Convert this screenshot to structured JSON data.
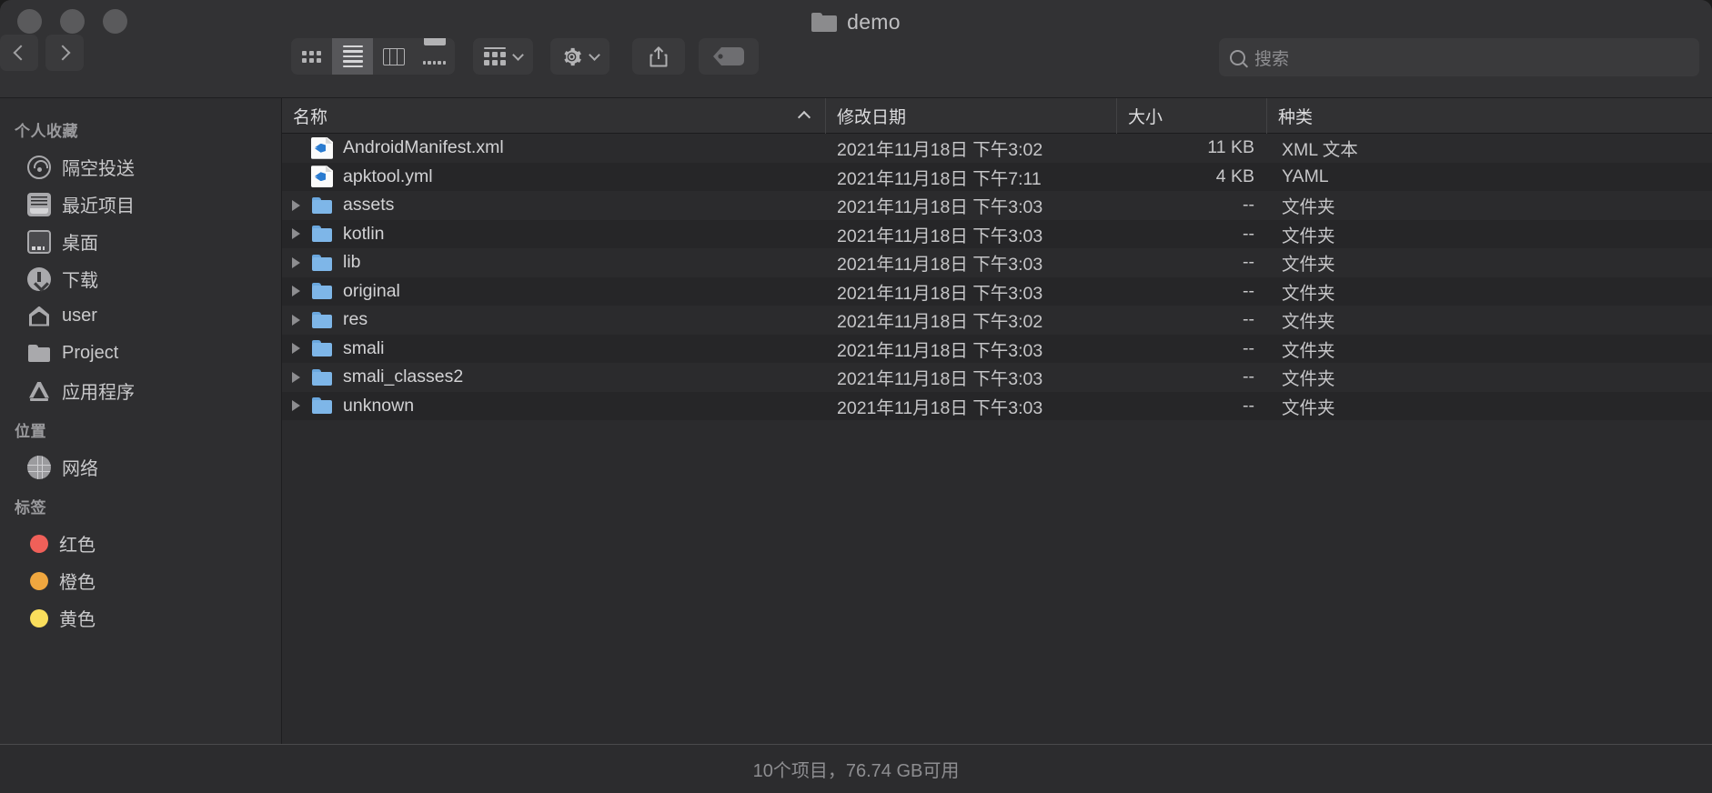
{
  "window": {
    "title": "demo",
    "traffic_lights": [
      "close",
      "minimize",
      "zoom"
    ]
  },
  "toolbar": {
    "back_label": "‹",
    "forward_label": "›",
    "view_modes": [
      {
        "name": "icon-view",
        "selected": false
      },
      {
        "name": "list-view",
        "selected": true
      },
      {
        "name": "column-view",
        "selected": false
      },
      {
        "name": "gallery-view",
        "selected": false
      }
    ],
    "group_by": "group-by",
    "actions": "actions",
    "share": "share",
    "tags": "tags"
  },
  "search": {
    "placeholder": "搜索",
    "value": ""
  },
  "sidebar": {
    "sections": [
      {
        "title": "个人收藏",
        "items": [
          {
            "label": "隔空投送",
            "icon": "airdrop-icon"
          },
          {
            "label": "最近项目",
            "icon": "recents-icon"
          },
          {
            "label": "桌面",
            "icon": "desktop-icon"
          },
          {
            "label": "下载",
            "icon": "downloads-icon"
          },
          {
            "label": "user",
            "icon": "home-icon"
          },
          {
            "label": "Project",
            "icon": "folder-icon"
          },
          {
            "label": "应用程序",
            "icon": "applications-icon"
          }
        ]
      },
      {
        "title": "位置",
        "items": [
          {
            "label": "网络",
            "icon": "network-icon"
          }
        ]
      },
      {
        "title": "标签",
        "items": [
          {
            "label": "红色",
            "icon": "tag-dot-icon",
            "color": "#f06059"
          },
          {
            "label": "橙色",
            "icon": "tag-dot-icon",
            "color": "#f0a73f"
          },
          {
            "label": "黄色",
            "icon": "tag-dot-icon",
            "color": "#fade5c"
          }
        ]
      }
    ]
  },
  "filelist": {
    "columns": [
      {
        "label": "名称",
        "sorted": "asc"
      },
      {
        "label": "修改日期",
        "sorted": ""
      },
      {
        "label": "大小",
        "sorted": ""
      },
      {
        "label": "种类",
        "sorted": ""
      }
    ],
    "rows": [
      {
        "name": "AndroidManifest.xml",
        "icon": "xml-file-icon",
        "expandable": false,
        "date": "2021年11月18日 下午3:02",
        "size": "11 KB",
        "kind": "XML 文本"
      },
      {
        "name": "apktool.yml",
        "icon": "xml-file-icon",
        "expandable": false,
        "date": "2021年11月18日 下午7:11",
        "size": "4 KB",
        "kind": "YAML"
      },
      {
        "name": "assets",
        "icon": "folder-icon",
        "expandable": true,
        "date": "2021年11月18日 下午3:03",
        "size": "--",
        "kind": "文件夹"
      },
      {
        "name": "kotlin",
        "icon": "folder-icon",
        "expandable": true,
        "date": "2021年11月18日 下午3:03",
        "size": "--",
        "kind": "文件夹"
      },
      {
        "name": "lib",
        "icon": "folder-icon",
        "expandable": true,
        "date": "2021年11月18日 下午3:03",
        "size": "--",
        "kind": "文件夹"
      },
      {
        "name": "original",
        "icon": "folder-icon",
        "expandable": true,
        "date": "2021年11月18日 下午3:03",
        "size": "--",
        "kind": "文件夹"
      },
      {
        "name": "res",
        "icon": "folder-icon",
        "expandable": true,
        "date": "2021年11月18日 下午3:02",
        "size": "--",
        "kind": "文件夹"
      },
      {
        "name": "smali",
        "icon": "folder-icon",
        "expandable": true,
        "date": "2021年11月18日 下午3:03",
        "size": "--",
        "kind": "文件夹"
      },
      {
        "name": "smali_classes2",
        "icon": "folder-icon",
        "expandable": true,
        "date": "2021年11月18日 下午3:03",
        "size": "--",
        "kind": "文件夹"
      },
      {
        "name": "unknown",
        "icon": "folder-icon",
        "expandable": true,
        "date": "2021年11月18日 下午3:03",
        "size": "--",
        "kind": "文件夹"
      }
    ]
  },
  "statusbar": {
    "text": "10个项目，76.74 GB可用"
  }
}
